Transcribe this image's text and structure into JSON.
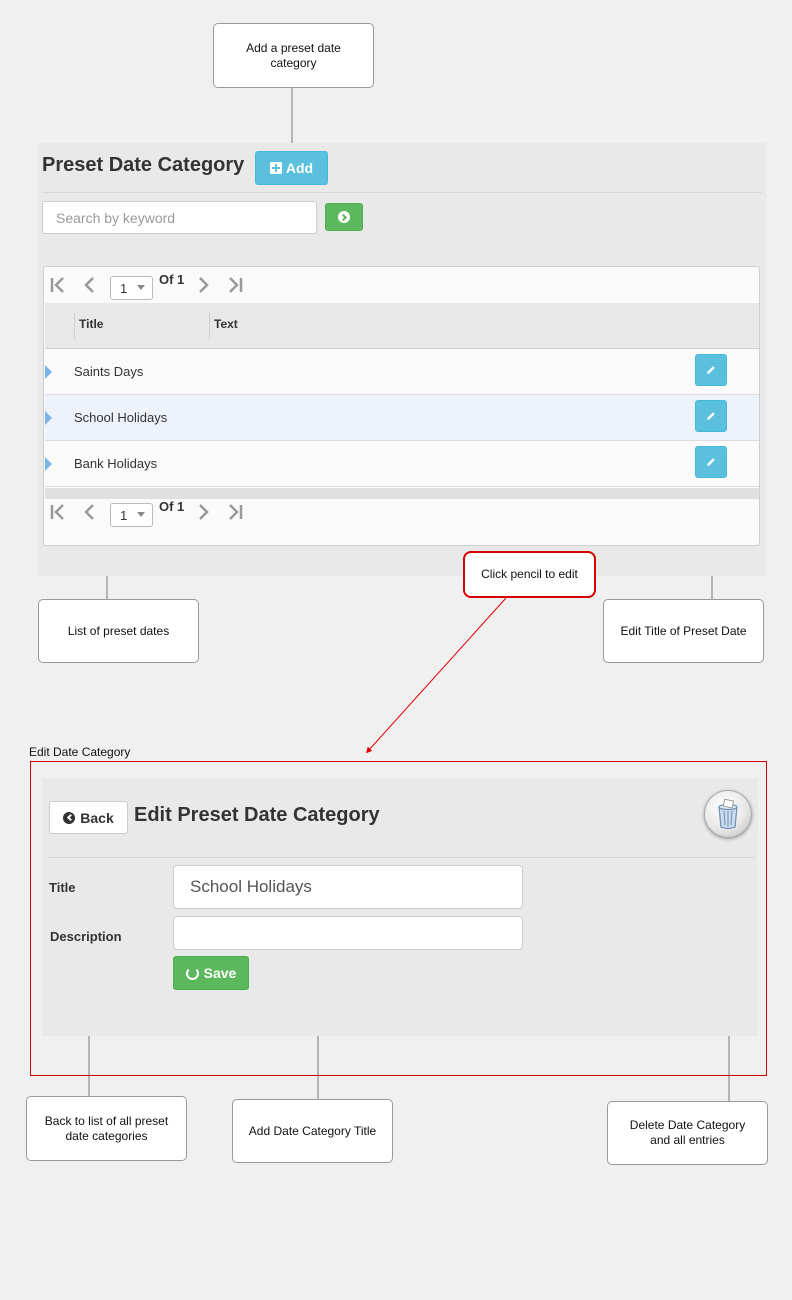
{
  "annotations": {
    "add_category": "Add a preset date category",
    "click_pencil": "Click pencil to edit",
    "list_of_dates": "List of preset dates",
    "edit_title": "Edit Title of Preset Date",
    "back_to_list": "Back to list of all preset date categories",
    "add_title": "Add Date Category Title",
    "delete_category": "Delete Date Category and all entries"
  },
  "list_view": {
    "title": "Preset Date Category",
    "add_label": "Add",
    "search_placeholder": "Search by keyword",
    "pager": {
      "page": "1",
      "of_label": "Of 1"
    },
    "columns": [
      "Title",
      "Text"
    ],
    "rows": [
      {
        "title": "Saints Days"
      },
      {
        "title": "School Holidays"
      },
      {
        "title": "Bank Holidays"
      }
    ]
  },
  "edit_view": {
    "caption": "Edit Date Category",
    "back_label": "Back",
    "title": "Edit Preset Date Category",
    "title_label": "Title",
    "title_value": "School Holidays",
    "description_label": "Description",
    "description_value": "",
    "save_label": "Save"
  },
  "colors": {
    "info": "#5bc0de",
    "success": "#5cb85c",
    "callout_red": "#d90000",
    "row_arrow": "#7ab3e8"
  }
}
